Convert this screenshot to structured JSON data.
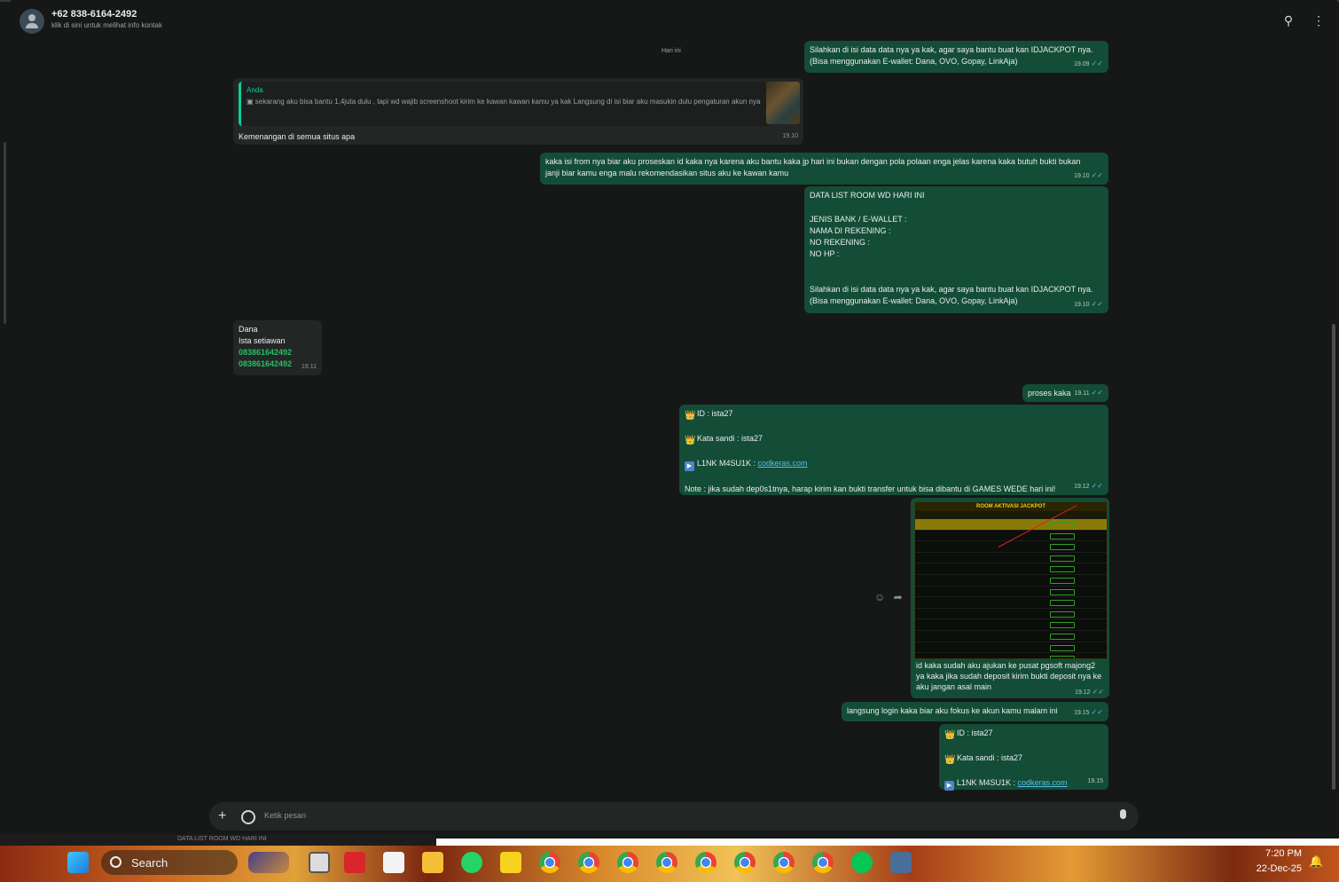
{
  "header": {
    "contact_name": "+62 838-6164-2492",
    "contact_sub": "klik di sini untuk melihat info kontak"
  },
  "day_chip": "Hari ini",
  "messages": {
    "m1": {
      "text1": "Silahkan di isi data data nya ya kak, agar saya bantu buat kan IDJACKPOT nya.",
      "text2": "(Bisa menggunakan E-wallet: Dana, OVO, Gopay, LinkAja)",
      "time": "19.09"
    },
    "m2": {
      "quote_name": "Anda",
      "quote_text": "sekarang aku bisa bantu 1,4juta dulu , tapi wd wajib screenshoot kirim ke kawan kawan kamu ya kak Langsung di isi biar aku masukin dulu pengaturan akun nya",
      "text": "Kemenangan di semua situs apa",
      "time": "19.10"
    },
    "m3": {
      "text": "kaka isi from nya biar aku proseskan id kaka nya karena aku bantu kaka jp hari ini bukan dengan pola polaan enga jelas karena kaka butuh bukti bukan janji biar kamu enga malu rekomendasikan situs aku ke kawan kamu",
      "time": "19.10"
    },
    "m4": {
      "l1": "DATA LIST ROOM WD HARI INI",
      "l2": "JENIS BANK / E-WALLET :",
      "l3": "NAMA DI REKENING :",
      "l4": "NO REKENING :",
      "l5": "NO HP :",
      "l6": "Silahkan di isi data data nya ya kak, agar saya bantu buat kan IDJACKPOT nya.",
      "l7": "(Bisa menggunakan E-wallet: Dana, OVO, Gopay, LinkAja)",
      "time": "19.10"
    },
    "m5": {
      "l1": "Dana",
      "l2": "Ista setiawan",
      "l3": "083861642492",
      "l4": "083861642492",
      "time": "19.11"
    },
    "m6": {
      "text": "proses kaka",
      "time": "19.11"
    },
    "m7": {
      "id": "ID :  ista27",
      "pass": "Kata sandi : ista27",
      "link_label": "L1NK M4SU1K : ",
      "link": "codkeras.com",
      "note": "Note : jika sudah dep0s1tnya, harap kirim kan bukti transfer untuk bisa dibantu di GAMES WEDE hari ini!",
      "time": "19.12"
    },
    "m8": {
      "image_title": "ROOM AKTIVASI JACKPOT",
      "caption": "id kaka sudah aku ajukan ke pusat pgsoft majong2 ya kaka jika sudah deposit kirim bukti deposit nya ke aku jangan asal main",
      "time": "19.12"
    },
    "m9": {
      "text": "langsung login kaka biar aku fokus ke akun kamu  malam ini",
      "time": "19.15"
    },
    "m10": {
      "id": "ID :  ista27",
      "pass": "Kata sandi : ista27",
      "link_label": "L1NK M4SU1K : ",
      "link": "codkeras.com",
      "time": "19.15"
    }
  },
  "composer": {
    "placeholder": "Ketik pesan"
  },
  "taskbar": {
    "search_label": "Search",
    "time": "7:20 PM",
    "date": "22-Dec-25"
  },
  "strip_text": "DATA LIST ROOM WD HARI INI",
  "colors": {
    "outgoing_bubble": "#144d37",
    "incoming_bubble": "#242626",
    "accent": "#21c063",
    "link": "#53bdeb"
  }
}
